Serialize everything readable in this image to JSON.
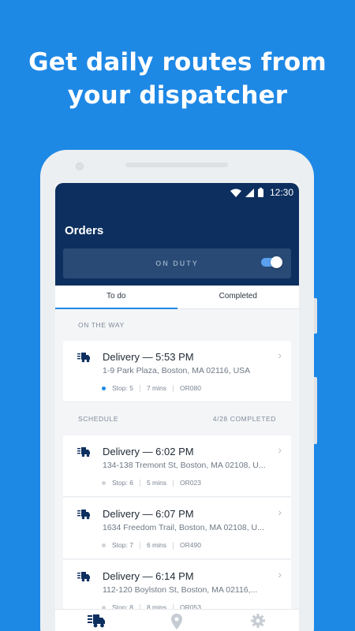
{
  "headline": {
    "line1": "Get daily routes from",
    "line2": "your dispatcher"
  },
  "status_bar": {
    "time": "12:30",
    "icons": [
      "wifi-icon",
      "signal-icon",
      "battery-icon"
    ]
  },
  "app_bar": {
    "title": "Orders",
    "duty_label": "ON DUTY",
    "duty_on": true
  },
  "tabs": [
    {
      "label": "To do",
      "active": true
    },
    {
      "label": "Completed",
      "active": false
    }
  ],
  "sections": {
    "on_the_way": {
      "label": "ON THE WAY"
    },
    "schedule": {
      "label": "SCHEDULE",
      "progress": "4/28 COMPLETED"
    }
  },
  "on_the_way_orders": [
    {
      "title": "Delivery — 5:53 PM",
      "address": "1-9 Park Plaza, Boston, MA 02116, USA",
      "stop": "Stop: 5",
      "duration": "7 mins",
      "order_id": "OR080",
      "active": true
    }
  ],
  "scheduled_orders": [
    {
      "title": "Delivery — 6:02 PM",
      "address": "134-138 Tremont St, Boston, MA 02108, U...",
      "stop": "Stop: 6",
      "duration": "5 mins",
      "order_id": "OR023"
    },
    {
      "title": "Delivery — 6:07 PM",
      "address": "1634 Freedom Trail, Boston, MA 02108, U...",
      "stop": "Stop: 7",
      "duration": "6 mins",
      "order_id": "OR490"
    },
    {
      "title": "Delivery — 6:14 PM",
      "address": "112-120 Boylston St, Boston, MA 02116,...",
      "stop": "Stop: 8",
      "duration": "8 mins",
      "order_id": "OR053"
    }
  ],
  "bottom_nav": [
    "orders-icon",
    "map-pin-icon",
    "settings-icon"
  ],
  "colors": {
    "background": "#1e88e5",
    "app_bar": "#0d2f5f",
    "accent": "#1e88e5"
  }
}
